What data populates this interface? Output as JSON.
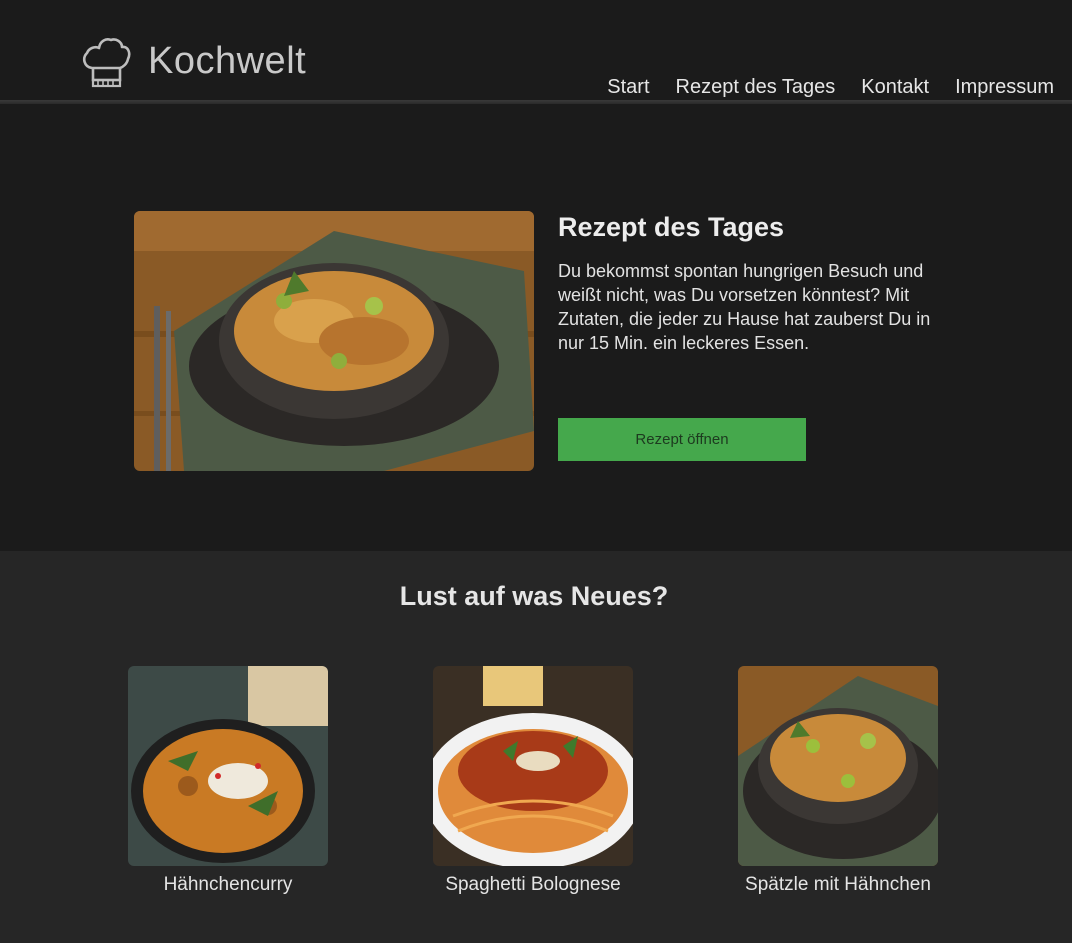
{
  "brand": {
    "name": "Kochwelt",
    "logo_icon": "chef-hat-icon"
  },
  "nav": {
    "items": [
      {
        "label": "Start"
      },
      {
        "label": "Rezept des Tages"
      },
      {
        "label": "Kontakt"
      },
      {
        "label": "Impressum"
      }
    ]
  },
  "hero": {
    "title": "Rezept des Tages",
    "text": "Du bekommst spontan hungrigen Besuch und weißt nicht, was Du vorsetzen könntest? Mit Zutaten, die jeder zu Hause hat zauberst Du in nur 15 Min. ein leckeres Essen.",
    "button_label": "Rezept öffnen"
  },
  "suggestions": {
    "title": "Lust auf was Neues?",
    "cards": [
      {
        "label": "Hähnchencurry"
      },
      {
        "label": "Spaghetti Bolognese"
      },
      {
        "label": "Spätzle mit Hähnchen"
      }
    ]
  },
  "colors": {
    "background": "#1b1b1b",
    "section_background": "#262626",
    "accent_button": "#45a84c"
  }
}
